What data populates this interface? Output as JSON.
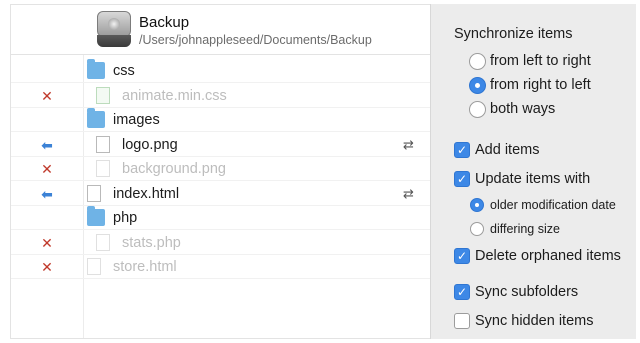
{
  "header": {
    "title": "Backup",
    "path": "/Users/johnappleseed/Documents/Backup",
    "icon": "hard-disk-icon"
  },
  "files": [
    {
      "name": "css",
      "kind": "folder",
      "action": "",
      "faded": false,
      "indent": 0
    },
    {
      "name": "animate.min.css",
      "kind": "file",
      "action": "delete",
      "faded": true,
      "indent": 1
    },
    {
      "name": "images",
      "kind": "folder",
      "action": "",
      "faded": false,
      "indent": 0
    },
    {
      "name": "logo.png",
      "kind": "file",
      "action": "copy-left",
      "faded": false,
      "indent": 1,
      "merge": true
    },
    {
      "name": "background.png",
      "kind": "file",
      "action": "delete",
      "faded": true,
      "indent": 1
    },
    {
      "name": "index.html",
      "kind": "file",
      "action": "copy-left",
      "faded": false,
      "indent": 0,
      "merge": true
    },
    {
      "name": "php",
      "kind": "folder",
      "action": "",
      "faded": false,
      "indent": 0
    },
    {
      "name": "stats.php",
      "kind": "file",
      "action": "delete",
      "faded": true,
      "indent": 1
    },
    {
      "name": "store.html",
      "kind": "file",
      "action": "delete",
      "faded": true,
      "indent": 0
    }
  ],
  "options": {
    "title": "Synchronize items",
    "direction": [
      {
        "label": "from left to right",
        "selected": false
      },
      {
        "label": "from right to left",
        "selected": true
      },
      {
        "label": "both ways",
        "selected": false
      }
    ],
    "add_items": {
      "label": "Add items",
      "checked": true
    },
    "update_items": {
      "label": "Update items with",
      "checked": true
    },
    "update_mode": [
      {
        "label": "older modification date",
        "selected": true
      },
      {
        "label": "differing size",
        "selected": false
      }
    ],
    "delete_orphaned": {
      "label": "Delete orphaned items",
      "checked": true
    },
    "sync_subfolders": {
      "label": "Sync subfolders",
      "checked": true
    },
    "sync_hidden": {
      "label": "Sync hidden items",
      "checked": false
    }
  },
  "colors": {
    "accent": "#3d88e6",
    "delete": "#c0392b",
    "folder": "#6fb3e6",
    "panel": "#ececec"
  }
}
